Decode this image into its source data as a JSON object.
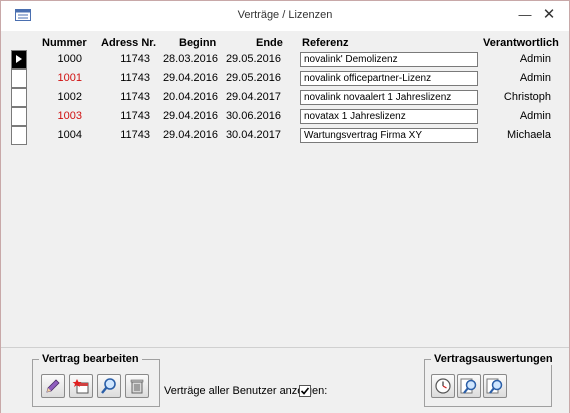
{
  "window": {
    "title": "Verträge / Lizenzen",
    "minimize_glyph": "—",
    "close_glyph": "✕"
  },
  "table": {
    "headers": {
      "nummer": "Nummer",
      "adress_nr": "Adress Nr.",
      "beginn": "Beginn",
      "ende": "Ende",
      "referenz": "Referenz",
      "verantwortlich": "Verantwortlich"
    },
    "rows": [
      {
        "nummer": "1000",
        "adress_nr": "11743",
        "beginn": "28.03.2016",
        "ende": "29.05.2016",
        "referenz": "novalink' Demolizenz",
        "verantwortlich": "Admin",
        "highlight": false
      },
      {
        "nummer": "1001",
        "adress_nr": "11743",
        "beginn": "29.04.2016",
        "ende": "29.05.2016",
        "referenz": "novalink officepartner-Lizenz",
        "verantwortlich": "Admin",
        "highlight": true
      },
      {
        "nummer": "1002",
        "adress_nr": "11743",
        "beginn": "20.04.2016",
        "ende": "29.04.2017",
        "referenz": "novalink novaalert 1 Jahreslizenz",
        "verantwortlich": "Christoph",
        "highlight": false
      },
      {
        "nummer": "1003",
        "adress_nr": "11743",
        "beginn": "29.04.2016",
        "ende": "30.06.2016",
        "referenz": "novatax 1 Jahreslizenz",
        "verantwortlich": "Admin",
        "highlight": true
      },
      {
        "nummer": "1004",
        "adress_nr": "11743",
        "beginn": "29.04.2016",
        "ende": "30.04.2017",
        "referenz": "Wartungsvertrag Firma XY",
        "verantwortlich": "Michaela",
        "highlight": false
      }
    ]
  },
  "footer": {
    "edit_group_label": "Vertrag bearbeiten",
    "edit_buttons": [
      "pencil-icon",
      "new-record-icon",
      "magnifier-icon",
      "trash-icon"
    ],
    "show_all_label": "Verträge aller Benutzer anzeigen:",
    "show_all_checked": true,
    "reports_group_label": "Vertragsauswertungen",
    "report_buttons": [
      "clock-icon",
      "report-search-icon",
      "report-search-alt-icon"
    ]
  },
  "colors": {
    "highlight_number": "#d01010",
    "window_bg": "#f0f0f0"
  }
}
